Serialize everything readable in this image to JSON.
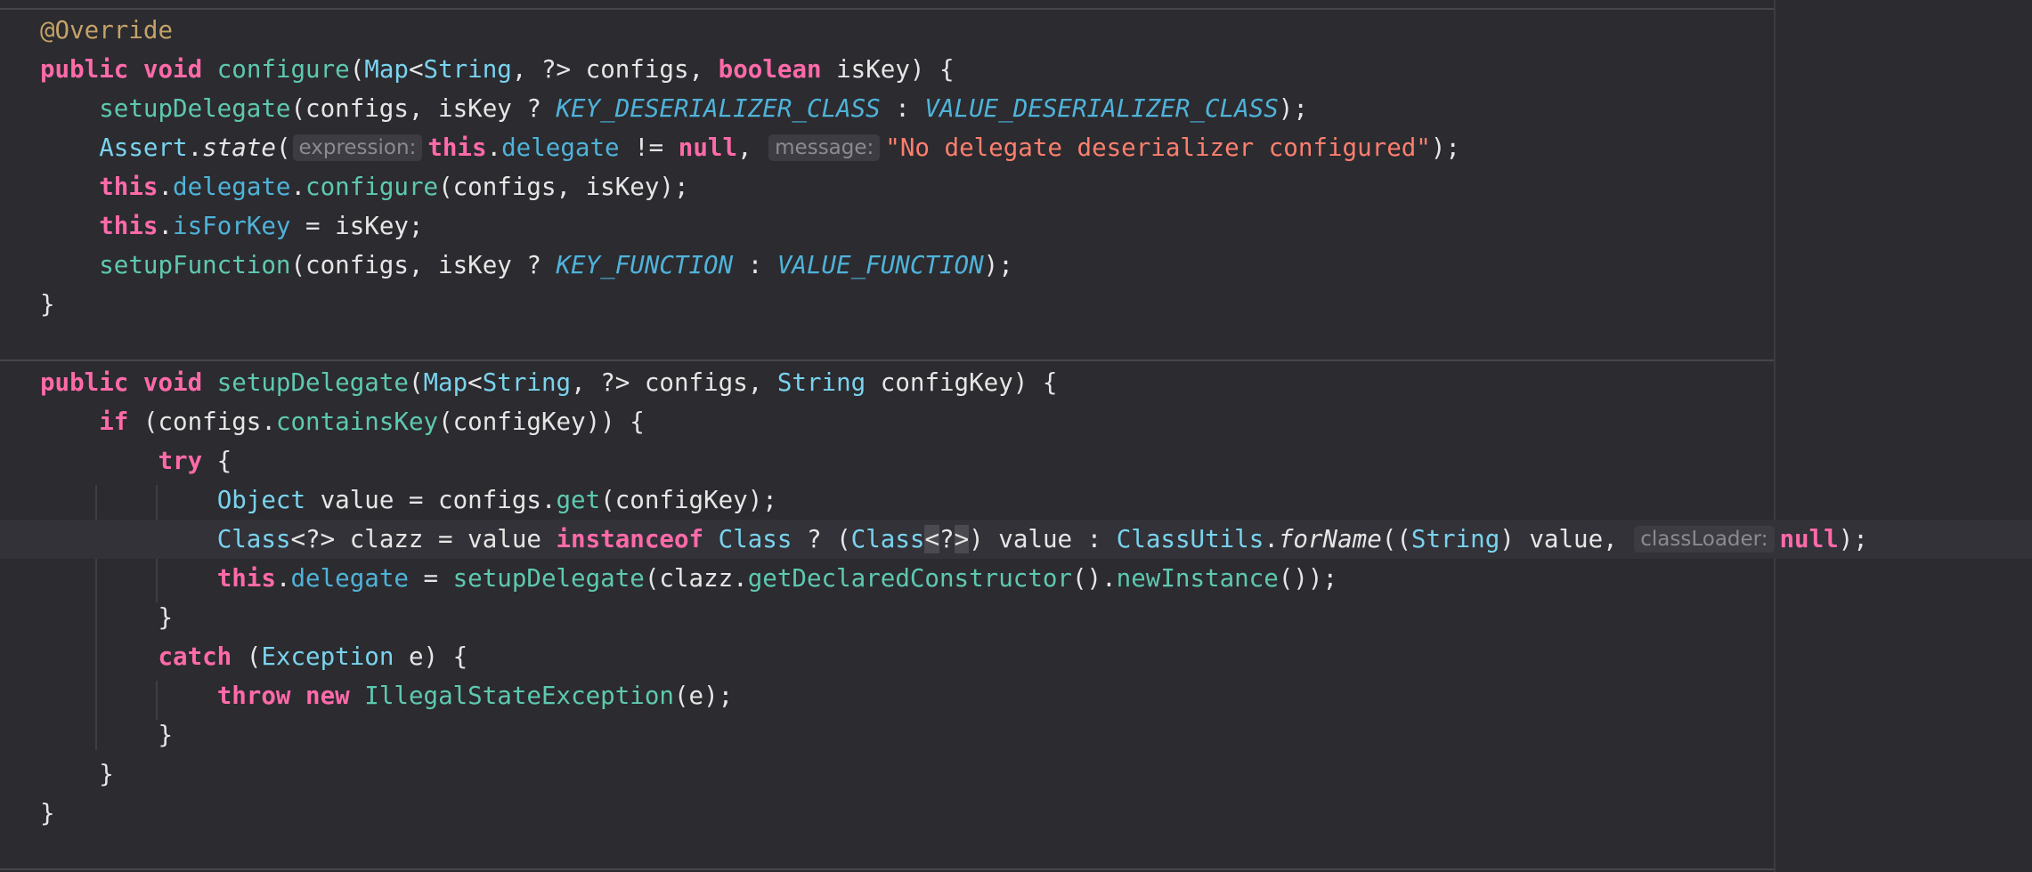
{
  "editor": {
    "hints": {
      "expression": "expression:",
      "message": "message:",
      "classLoader": "classLoader:"
    },
    "tokens": {
      "override": "@Override",
      "public": "public",
      "void": "void",
      "boolean": "boolean",
      "this": "this",
      "null": "null",
      "if": "if",
      "try": "try",
      "catch": "catch",
      "throw": "throw",
      "new": "new",
      "instanceof": "instanceof",
      "Map": "Map",
      "String": "String",
      "Object": "Object",
      "Class": "Class",
      "Exception": "Exception",
      "Assert": "Assert",
      "ClassUtils": "ClassUtils",
      "configure": "configure",
      "setupDelegate": "setupDelegate",
      "setupFunction": "setupFunction",
      "containsKey": "containsKey",
      "get": "get",
      "getDeclaredConstructor": "getDeclaredConstructor",
      "newInstance": "newInstance",
      "IllegalStateException": "IllegalStateException",
      "state": "state",
      "forName": "forName",
      "delegate": "delegate",
      "isForKey": "isForKey",
      "KEY_DESERIALIZER_CLASS": "KEY_DESERIALIZER_CLASS",
      "VALUE_DESERIALIZER_CLASS": "VALUE_DESERIALIZER_CLASS",
      "KEY_FUNCTION": "KEY_FUNCTION",
      "VALUE_FUNCTION": "VALUE_FUNCTION",
      "message_str": "\"No delegate deserializer configured\""
    },
    "plain": {
      "l2_open": "(",
      "l2_generic": "<",
      "l2_mid": ", ?> configs, ",
      "l2_end": " isKey) {",
      "l3_a": "(configs, isKey ? ",
      "l3_b": " : ",
      "l3_end": ");",
      "dot": ".",
      "l4_open": "(",
      "l4_cmp": " != ",
      "l4_comma": ", ",
      "l4_end": ");",
      "l5_end": "(configs, isKey);",
      "l6_end": " = isKey;",
      "l7_a": "(configs, isKey ? ",
      "l7_b": " : ",
      "l7_end": ");",
      "close": "}",
      "l10_open": "(",
      "l10_generic": "<",
      "l10_mid": ", ?> configs, ",
      "l10_end": " configKey) {",
      "l11_open": " (configs.",
      "l11_end": "(configKey)) {",
      "l12_end": " {",
      "l13_mid": " value = configs.",
      "l13_end": "(configKey);",
      "l14_a": "<?> clazz = value ",
      "l14_sp": " ",
      "l14_b": " ? (",
      "l14_lt": "<",
      "l14_q": "?",
      "l14_gt": ">",
      "l14_c": ") value : ",
      "l14_d": "((",
      "l14_e": ") value, ",
      "l14_end": ");",
      "l15_mid": " = ",
      "l15_a": "(clazz.",
      "l15_b": "().",
      "l15_end": "());",
      "l17_mid": " (",
      "l17_end": " e) {",
      "l18_sp": " ",
      "l18_end": "(e);"
    }
  }
}
